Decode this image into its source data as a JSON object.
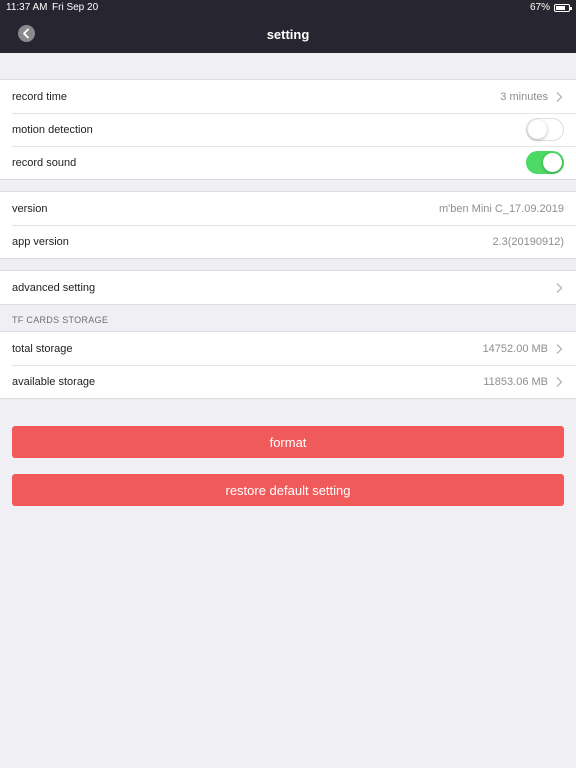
{
  "status_bar": {
    "time": "11:37 AM",
    "date": "Fri Sep 20",
    "battery": "67%"
  },
  "nav": {
    "title": "setting"
  },
  "group1": {
    "record_time": {
      "label": "record time",
      "value": "3 minutes"
    },
    "motion_detection": {
      "label": "motion detection",
      "enabled": false
    },
    "record_sound": {
      "label": "record sound",
      "enabled": true
    }
  },
  "group2": {
    "version": {
      "label": "version",
      "value": "m'ben Mini C_17.09.2019"
    },
    "app_version": {
      "label": "app version",
      "value": "2.3(20190912)"
    }
  },
  "group3": {
    "advanced": {
      "label": "advanced setting"
    }
  },
  "storage": {
    "header": "TF CARDS STORAGE",
    "total": {
      "label": "total storage",
      "value": "14752.00 MB"
    },
    "available": {
      "label": "available storage",
      "value": "11853.06 MB"
    }
  },
  "buttons": {
    "format": "format",
    "restore": "restore default setting"
  },
  "colors": {
    "nav_bg": "#272630",
    "toggle_on": "#4cd964",
    "danger": "#f05a5b"
  }
}
